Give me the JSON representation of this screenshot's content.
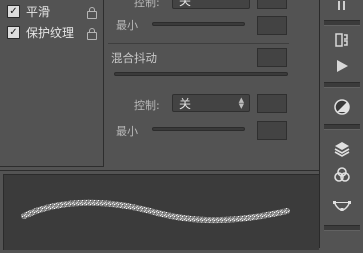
{
  "options": [
    {
      "label": "平滑",
      "checked": true
    },
    {
      "label": "保护纹理",
      "checked": true
    }
  ],
  "top_control": {
    "label": "控制:",
    "value": "关"
  },
  "top_min_label": "最小",
  "section": {
    "title": "混合抖动"
  },
  "control": {
    "label": "控制:",
    "value": "关"
  },
  "min_label": "最小",
  "toolbar": {
    "icons": [
      "pause-icon",
      "brush-presets-icon",
      "play-icon",
      "color-circle-icon",
      "layers-icon",
      "channels-icon",
      "paths-icon"
    ]
  },
  "colors": {
    "panel": "#535353",
    "field": "#434343",
    "preview_bg": "#3b3b3b"
  }
}
